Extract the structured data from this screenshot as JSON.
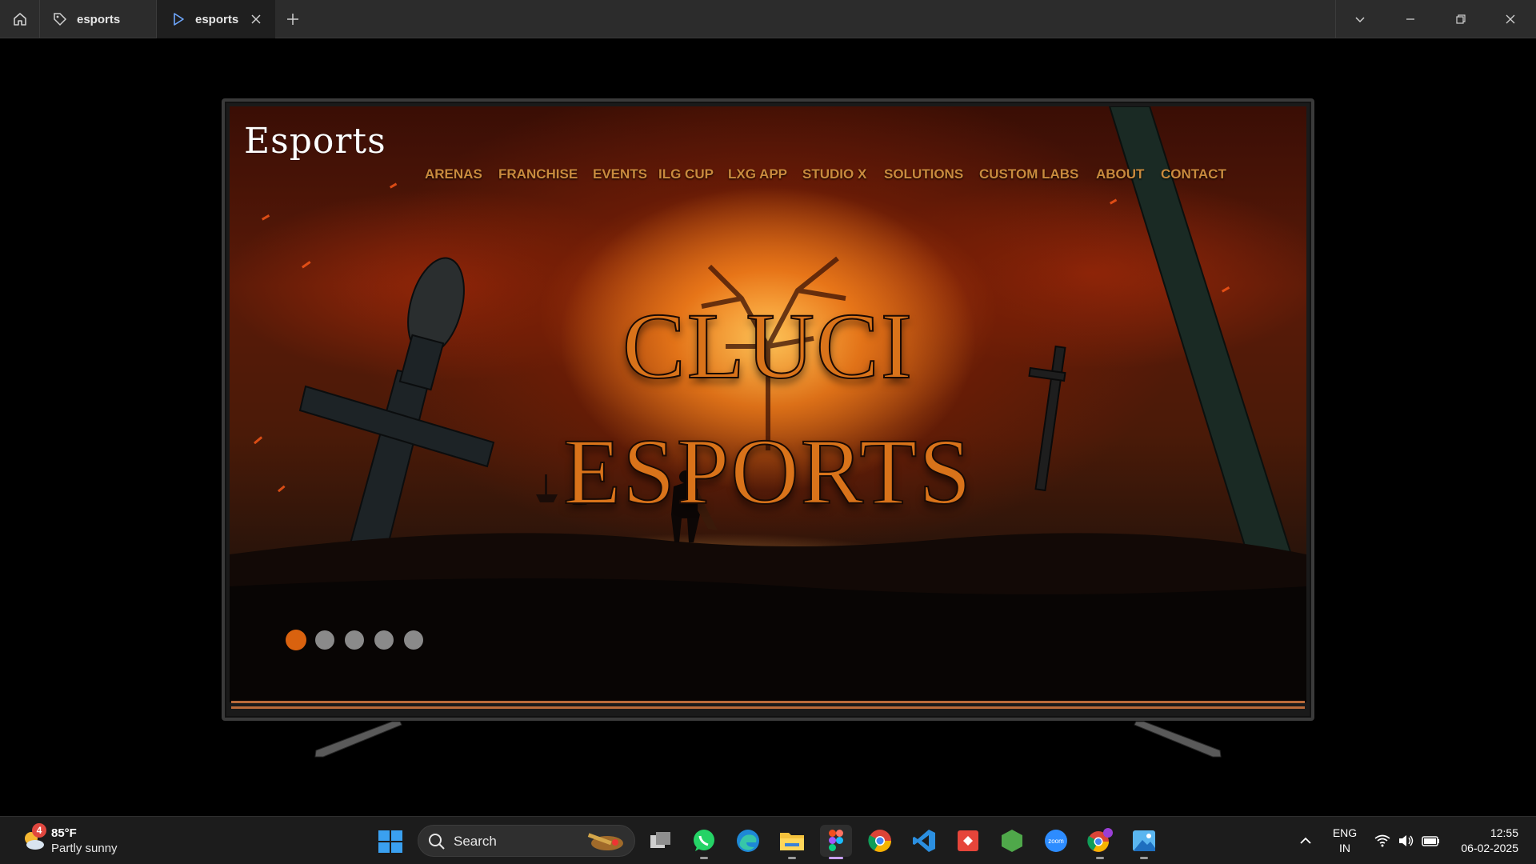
{
  "window": {
    "tabs": [
      {
        "label": "esports",
        "icon": "tag-icon",
        "active": false
      },
      {
        "label": "esports",
        "icon": "play-icon",
        "active": true
      }
    ]
  },
  "site": {
    "brand": "Esports",
    "nav": [
      "ARENAS",
      "FRANCHISE",
      "EVENTS",
      "ILG CUP",
      "LXG APP",
      "STUDIO X",
      "SOLUTIONS",
      "CUSTOM LABS",
      "ABOUT",
      "CONTACT"
    ],
    "hero_line1": "CLUCI",
    "hero_line2": "ESPORTS",
    "carousel": {
      "slide_count": 5,
      "active_index": 0
    },
    "colors": {
      "nav": "#c98a3d",
      "hero": "#d9731a",
      "active_dot": "#d9620f",
      "inactive_dot": "#8a8a8a"
    }
  },
  "taskbar": {
    "weather": {
      "badge": "4",
      "temp": "85°F",
      "desc": "Partly sunny"
    },
    "search_label": "Search",
    "apps": [
      "task-view-icon",
      "whatsapp-icon",
      "edge-icon",
      "file-explorer-icon",
      "figma-icon",
      "chrome-icon",
      "vscode-icon",
      "git-icon",
      "nodejs-icon",
      "zoom-icon",
      "chrome-profile-icon",
      "photos-icon"
    ],
    "lang_top": "ENG",
    "lang_bottom": "IN",
    "time": "12:55",
    "date": "06-02-2025"
  }
}
